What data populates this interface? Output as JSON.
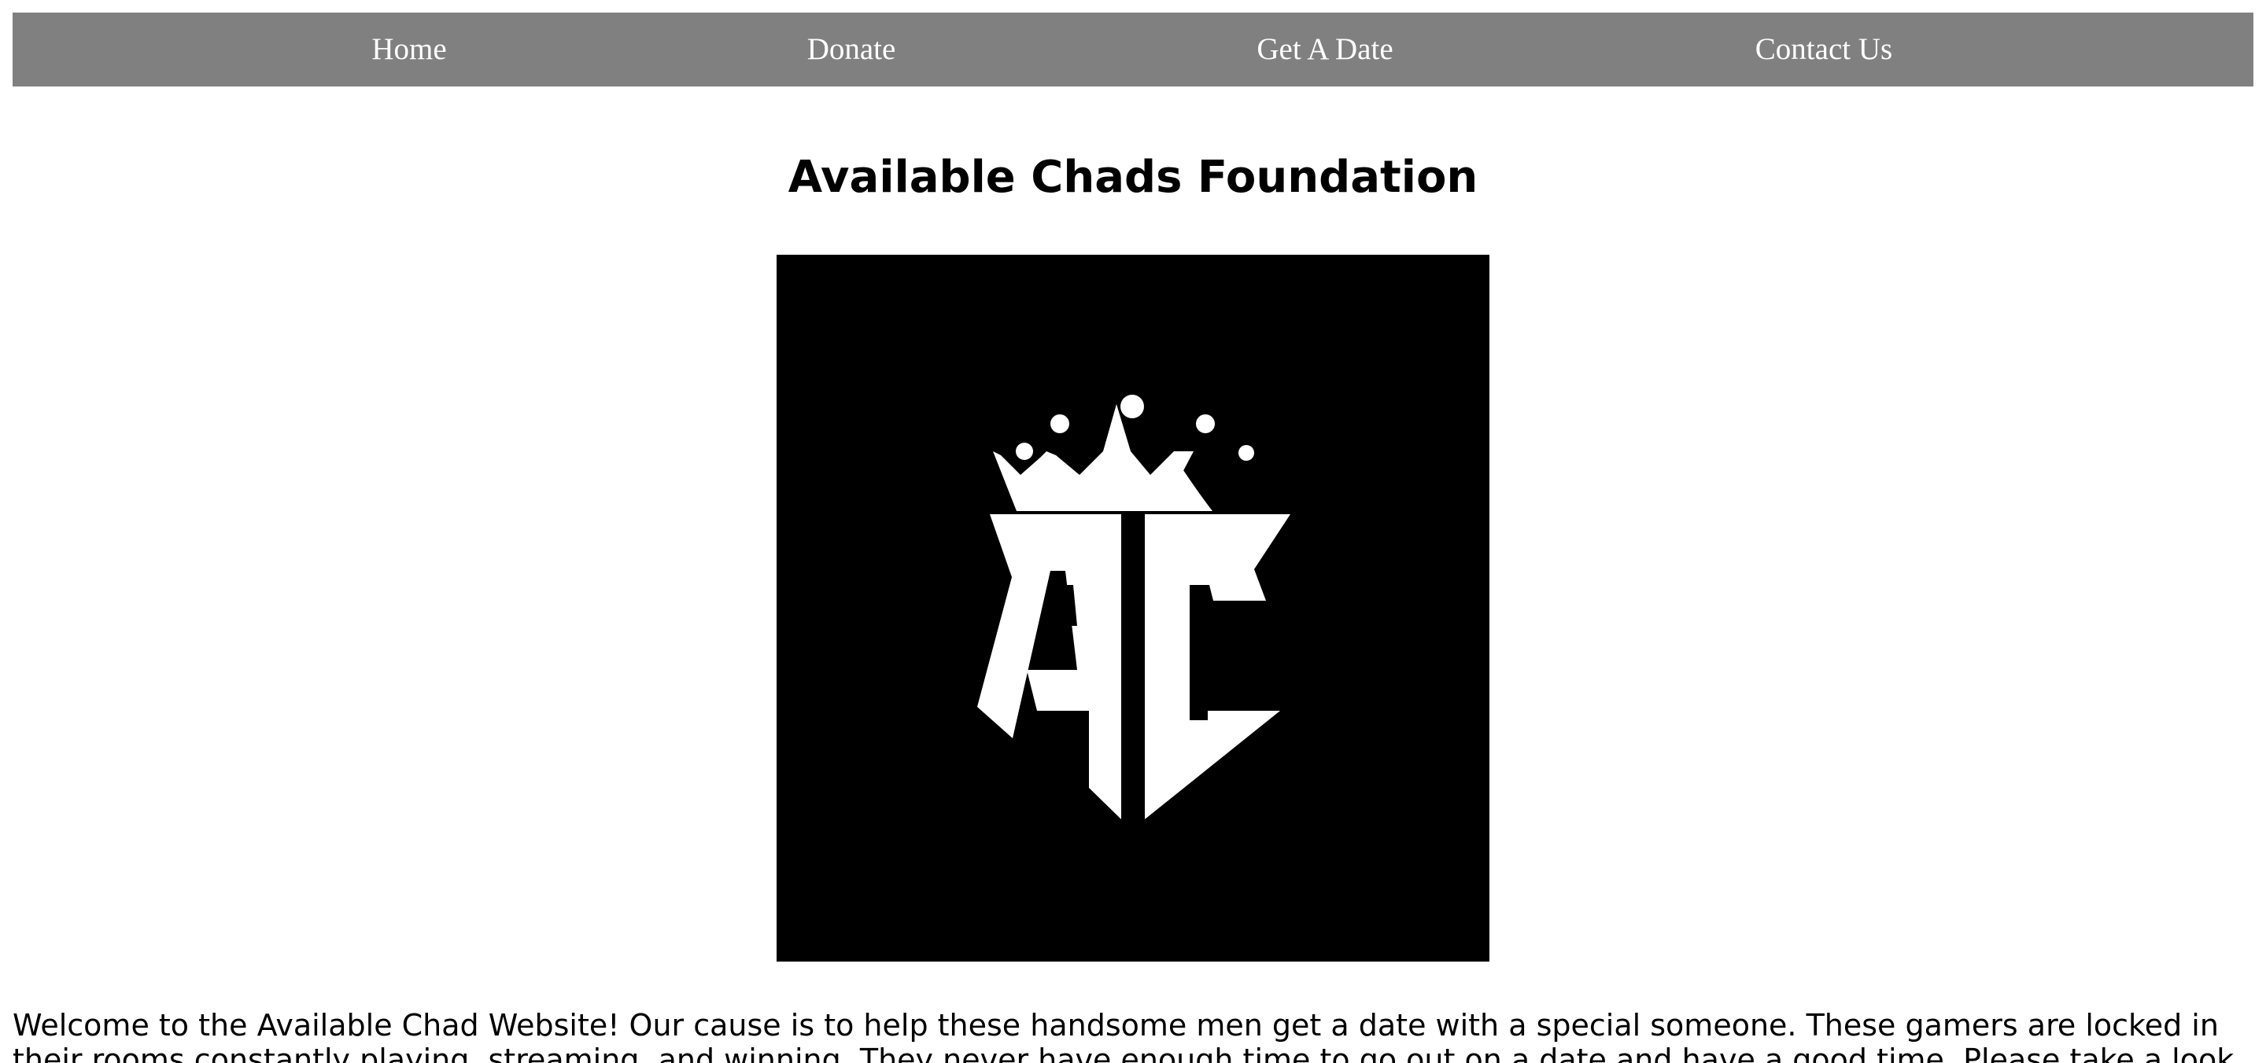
{
  "nav": {
    "items": [
      {
        "label": "Home"
      },
      {
        "label": "Donate"
      },
      {
        "label": "Get A Date"
      },
      {
        "label": "Contact Us"
      }
    ],
    "background": "#808080",
    "text_color": "#ffffff"
  },
  "main": {
    "title": "Available Chads Foundation",
    "logo": {
      "icon": "crown-ac-logo",
      "text": "AC",
      "background": "#000000",
      "foreground": "#ffffff"
    },
    "intro": "Welcome to the Available Chad Website! Our cause is to help these handsome men get a date with a special someone. These gamers are locked in their rooms constantly playing, streaming, and winning. They never have enough time to go out on a date and have a good time. Please take a look through our many options of"
  }
}
